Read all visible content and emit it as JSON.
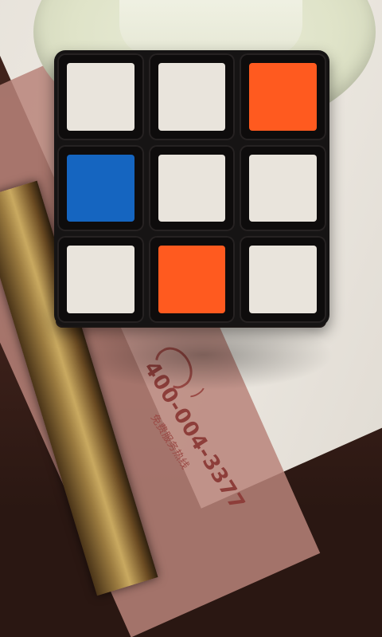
{
  "scene": {
    "subject": "rubiks-cube",
    "background_colors": {
      "placemat": "#e7e2da",
      "placemat_stripe": "#b8847a",
      "saucer": "#dfe3c8",
      "table": "#3a2019",
      "rail": "#c9a960"
    }
  },
  "cube": {
    "face_colors": [
      [
        "#e9e4dc",
        "#e9e4dc",
        "#ff5a1f"
      ],
      [
        "#1565c0",
        "#e9e4dc",
        "#e9e4dc"
      ],
      [
        "#e9e4dc",
        "#ff5a1f",
        "#e9e4dc"
      ]
    ],
    "cubie_color": "#0e0c0c"
  },
  "placemat_print": {
    "phone_number": "400-004-3377",
    "caption": "免费服务热线"
  }
}
